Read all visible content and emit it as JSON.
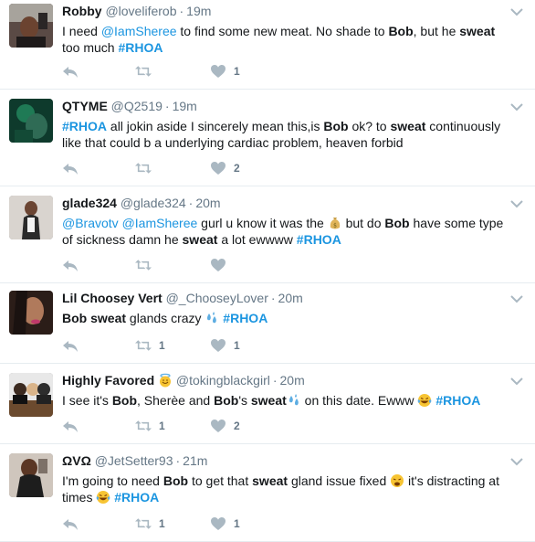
{
  "tweets": [
    {
      "name": "Robby",
      "handle": "@loveliferob",
      "time": "19m",
      "segments": [
        {
          "t": "I need "
        },
        {
          "t": "@IamSheree",
          "link": true
        },
        {
          "t": " to find some new meat. No shade to "
        },
        {
          "t": "Bob",
          "b": true
        },
        {
          "t": ", but he "
        },
        {
          "t": "sweat",
          "b": true
        },
        {
          "br": true
        },
        {
          "t": "too much "
        },
        {
          "t": "#RHOA",
          "link": true,
          "b": true
        }
      ],
      "retweets": "",
      "likes": "1"
    },
    {
      "name": "QTYME",
      "handle": "@Q2519",
      "time": "19m",
      "segments": [
        {
          "t": "#RHOA",
          "link": true,
          "b": true
        },
        {
          "t": " all jokin aside  I sincerely mean this,is "
        },
        {
          "t": "Bob",
          "b": true
        },
        {
          "t": " ok? to "
        },
        {
          "t": "sweat",
          "b": true
        },
        {
          "t": " continuously"
        },
        {
          "br": true
        },
        {
          "t": "like that could b a underlying cardiac problem, heaven forbid"
        }
      ],
      "retweets": "",
      "likes": "2"
    },
    {
      "name": "glade324",
      "handle": "@glade324",
      "time": "20m",
      "segments": [
        {
          "t": "@Bravotv",
          "link": true
        },
        {
          "t": " "
        },
        {
          "t": "@IamSheree",
          "link": true
        },
        {
          "t": " gurl u know it was the "
        },
        {
          "emoji": "moneybag-emoji"
        },
        {
          "t": " but do "
        },
        {
          "t": "Bob",
          "b": true
        },
        {
          "t": " have some type"
        },
        {
          "br": true
        },
        {
          "t": "of sickness damn he "
        },
        {
          "t": "sweat",
          "b": true
        },
        {
          "t": " a lot ewwww "
        },
        {
          "t": "#RHOA",
          "link": true,
          "b": true
        }
      ],
      "retweets": "",
      "likes": ""
    },
    {
      "name": "Lil Choosey Vert",
      "handle": "@_ChooseyLover",
      "time": "20m",
      "segments": [
        {
          "t": "Bob",
          "b": true
        },
        {
          "t": " "
        },
        {
          "t": "sweat",
          "b": true
        },
        {
          "t": " glands crazy "
        },
        {
          "emoji": "sweat-droplets-emoji"
        },
        {
          "t": " "
        },
        {
          "t": "#RHOA",
          "link": true,
          "b": true
        }
      ],
      "retweets": "1",
      "likes": "1"
    },
    {
      "name": "Highly Favored",
      "handle": "@tokingblackgirl",
      "time": "20m",
      "name_emoji": "halo-smile-emoji",
      "segments": [
        {
          "t": "I see it's "
        },
        {
          "t": "Bob",
          "b": true
        },
        {
          "t": ", Sherèe and "
        },
        {
          "t": "Bob",
          "b": true
        },
        {
          "t": "'s "
        },
        {
          "t": "sweat",
          "b": true
        },
        {
          "emoji": "sweat-droplets-emoji"
        },
        {
          "t": " on this date. Ewww "
        },
        {
          "emoji": "tears-of-joy-emoji"
        },
        {
          "t": " "
        },
        {
          "t": "#RHOA",
          "link": true,
          "b": true
        }
      ],
      "retweets": "1",
      "likes": "2"
    },
    {
      "name": "ΩVΩ",
      "handle": "@JetSetter93",
      "time": "21m",
      "segments": [
        {
          "t": "I'm going to need "
        },
        {
          "t": "Bob",
          "b": true
        },
        {
          "t": " to get that "
        },
        {
          "t": "sweat",
          "b": true
        },
        {
          "t": " gland issue fixed "
        },
        {
          "emoji": "weary-face-emoji"
        },
        {
          "t": " it's distracting at"
        },
        {
          "br": true
        },
        {
          "t": "times "
        },
        {
          "emoji": "tears-of-joy-emoji"
        },
        {
          "t": " "
        },
        {
          "t": "#RHOA",
          "link": true,
          "b": true
        }
      ],
      "retweets": "1",
      "likes": "1"
    }
  ],
  "colors": {
    "link": "#1b95e0",
    "meta": "#657786",
    "action_icon": "#aab8c2",
    "divider": "#e6ecf0"
  }
}
